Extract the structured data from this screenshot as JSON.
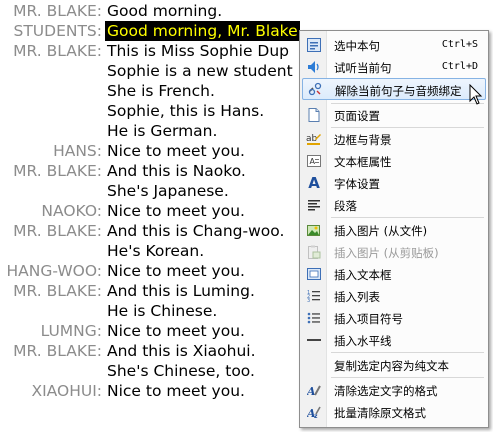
{
  "dialogue": [
    {
      "speaker": "MR. BLAKE:",
      "text": "Good morning."
    },
    {
      "speaker": "STUDENTS:",
      "text": "Good morning, Mr. Blake",
      "highlighted": true
    },
    {
      "speaker": "MR. BLAKE:",
      "text": "This is Miss Sophie Dup"
    },
    {
      "speaker": "",
      "text": "Sophie is a new student"
    },
    {
      "speaker": "",
      "text": "She is French."
    },
    {
      "speaker": "",
      "text": "Sophie, this is Hans."
    },
    {
      "speaker": "",
      "text": "He is German."
    },
    {
      "speaker": "HANS:",
      "text": "Nice to meet you."
    },
    {
      "speaker": "MR. BLAKE:",
      "text": "And this is Naoko."
    },
    {
      "speaker": "",
      "text": "She's Japanese."
    },
    {
      "speaker": "NAOKO:",
      "text": "Nice to meet you."
    },
    {
      "speaker": "MR. BLAKE:",
      "text": "And this is Chang-woo."
    },
    {
      "speaker": "",
      "text": "He's Korean."
    },
    {
      "speaker": "HANG-WOO:",
      "text": "Nice to meet you."
    },
    {
      "speaker": "MR. BLAKE:",
      "text": "And this is Luming."
    },
    {
      "speaker": "",
      "text": "He is Chinese."
    },
    {
      "speaker": "LUMNG:",
      "text": "Nice to meet you."
    },
    {
      "speaker": "MR. BLAKE:",
      "text": "And this is Xiaohui."
    },
    {
      "speaker": "",
      "text": "She's Chinese, too."
    },
    {
      "speaker": "XIAOHUI:",
      "text": "Nice to meet you."
    }
  ],
  "menu": {
    "items": [
      {
        "label": "选中本句",
        "shortcut": "Ctrl+S",
        "icon": "select-sentence-icon"
      },
      {
        "label": "试听当前句",
        "shortcut": "Ctrl+D",
        "icon": "speaker-icon"
      },
      {
        "label": "解除当前句子与音频绑定",
        "shortcut": "",
        "icon": "unlink-icon",
        "selected": true
      },
      {
        "label": "页面设置",
        "shortcut": "",
        "icon": "page-setup-icon"
      },
      {
        "label": "边框与背景",
        "shortcut": "",
        "icon": "border-background-icon"
      },
      {
        "label": "文本框属性",
        "shortcut": "",
        "icon": "textbox-properties-icon"
      },
      {
        "label": "字体设置",
        "shortcut": "",
        "icon": "font-icon"
      },
      {
        "label": "段落",
        "shortcut": "",
        "icon": "paragraph-icon"
      },
      {
        "label": "插入图片 (从文件)",
        "shortcut": "",
        "icon": "insert-image-file-icon"
      },
      {
        "label": "插入图片 (从剪贴板)",
        "shortcut": "",
        "icon": "insert-image-clipboard-icon",
        "disabled": true
      },
      {
        "label": "插入文本框",
        "shortcut": "",
        "icon": "insert-textbox-icon"
      },
      {
        "label": "插入列表",
        "shortcut": "",
        "icon": "insert-list-icon"
      },
      {
        "label": "插入项目符号",
        "shortcut": "",
        "icon": "insert-bullets-icon"
      },
      {
        "label": "插入水平线",
        "shortcut": "",
        "icon": "insert-hline-icon"
      },
      {
        "label": "复制选定内容为纯文本",
        "shortcut": "",
        "icon": ""
      },
      {
        "label": "清除选定文字的格式",
        "shortcut": "",
        "icon": "clear-format-icon"
      },
      {
        "label": "批量清除原文格式",
        "shortcut": "",
        "icon": "batch-clear-format-icon"
      }
    ]
  },
  "colors": {
    "highlight_bg": "#000000",
    "highlight_text": "#ffff00",
    "speaker_text": "#8c8c8c",
    "menu_selected_border": "#86b3e4"
  }
}
